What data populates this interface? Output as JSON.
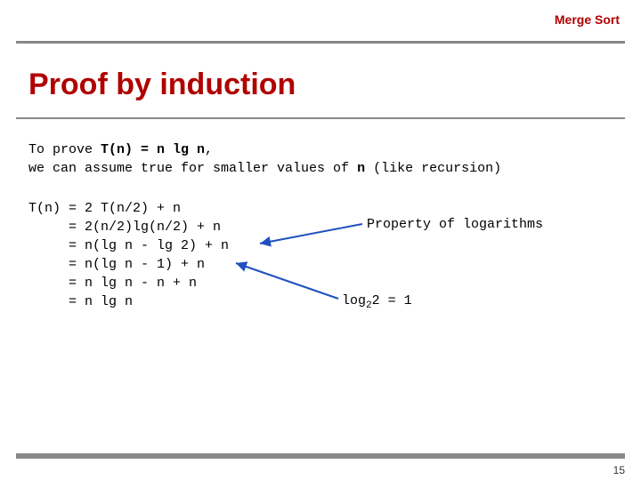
{
  "header": {
    "label": "Merge Sort"
  },
  "title": "Proof by induction",
  "intro": {
    "line1_pre": "To prove ",
    "line1_bold": "T(n) = n lg n",
    "line1_post": ",",
    "line2_pre": "we can assume true for smaller values of ",
    "line2_bold": "n",
    "line2_post": " (like recursion)"
  },
  "proof": {
    "lhs": "T(n)",
    "lines": [
      "= 2 T(n/2) + n",
      "= 2(n/2)lg(n/2) + n",
      "= n(lg n - lg 2) + n",
      "= n(lg n - 1) + n",
      "= n lg n - n + n",
      "= n lg n"
    ]
  },
  "annotations": {
    "property": "Property of logarithms",
    "log_pre": "log",
    "log_sub": "2",
    "log_post": "2 = 1"
  },
  "page_number": "15"
}
